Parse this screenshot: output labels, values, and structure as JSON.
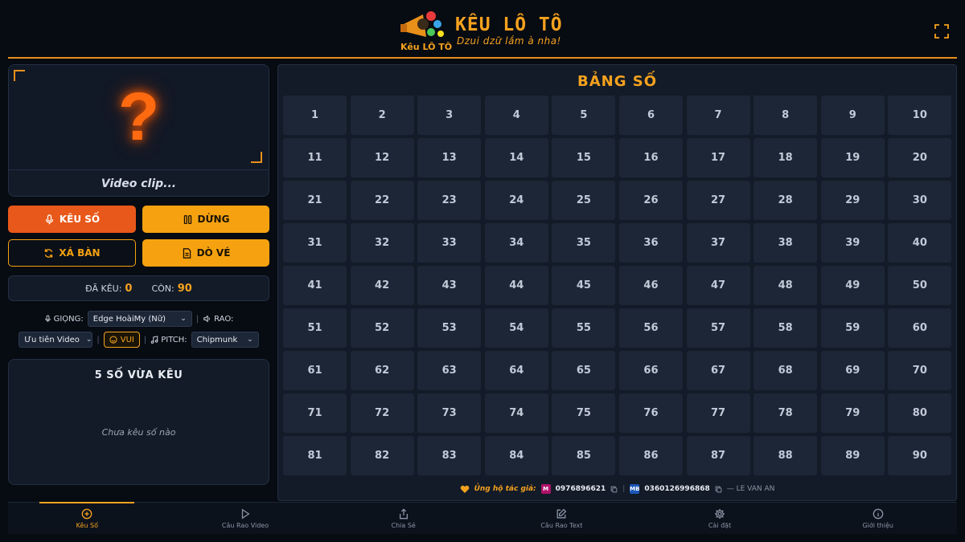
{
  "header": {
    "title": "KÊU LÔ TÔ",
    "tagline": "Dzui dzữ lắm à nha!",
    "logo_text": "Kêu LÔ TÔ"
  },
  "video": {
    "placeholder_glyph": "?",
    "caption": "Video clip..."
  },
  "controls": {
    "keu_so": "KÊU SỐ",
    "dung": "DỪNG",
    "xa_ban": "XÁ BÀN",
    "do_ve": "DÒ VÉ"
  },
  "counter": {
    "called_label": "ĐÃ KÊU:",
    "called_value": "0",
    "remaining_label": "CÒN:",
    "remaining_value": "90"
  },
  "settings": {
    "voice_label": "GIỌNG:",
    "voice_value": "Edge HoàiMy (Nữ)",
    "rao_label": "RAO:",
    "priority_value": "Ưu tiên Video",
    "mood_label": "VUI",
    "pitch_label": "PITCH:",
    "pitch_value": "Chipmunk"
  },
  "recent": {
    "title": "5 SỐ VỪA KÊU",
    "empty": "Chưa kêu số nào"
  },
  "board": {
    "title": "BẢNG SỐ",
    "numbers": [
      "1",
      "2",
      "3",
      "4",
      "5",
      "6",
      "7",
      "8",
      "9",
      "10",
      "11",
      "12",
      "13",
      "14",
      "15",
      "16",
      "17",
      "18",
      "19",
      "20",
      "21",
      "22",
      "23",
      "24",
      "25",
      "26",
      "27",
      "28",
      "29",
      "30",
      "31",
      "32",
      "33",
      "34",
      "35",
      "36",
      "37",
      "38",
      "39",
      "40",
      "41",
      "42",
      "43",
      "44",
      "45",
      "46",
      "47",
      "48",
      "49",
      "50",
      "51",
      "52",
      "53",
      "54",
      "55",
      "56",
      "57",
      "58",
      "59",
      "60",
      "61",
      "62",
      "63",
      "64",
      "65",
      "66",
      "67",
      "68",
      "69",
      "70",
      "71",
      "72",
      "73",
      "74",
      "75",
      "76",
      "77",
      "78",
      "79",
      "80",
      "81",
      "82",
      "83",
      "84",
      "85",
      "86",
      "87",
      "88",
      "89",
      "90"
    ]
  },
  "support": {
    "label": "Ủng hộ tác giả:",
    "bank1_badge": "M",
    "phone1": "0976896621",
    "bank2_badge": "MB",
    "phone2": "0360126996868",
    "author": "— LE VAN AN"
  },
  "nav": {
    "items": [
      {
        "label": "Kêu Số",
        "icon": "plus-circle-icon"
      },
      {
        "label": "Câu Rao Video",
        "icon": "play-icon"
      },
      {
        "label": "Chia Sẻ",
        "icon": "share-icon"
      },
      {
        "label": "Câu Rao Text",
        "icon": "edit-icon"
      },
      {
        "label": "Cài đặt",
        "icon": "gear-icon"
      },
      {
        "label": "Giới thiệu",
        "icon": "info-icon"
      }
    ]
  },
  "colors": {
    "accent": "#f6a21e",
    "danger": "#e8581a",
    "background": "#070b12",
    "panel": "#131b28"
  }
}
